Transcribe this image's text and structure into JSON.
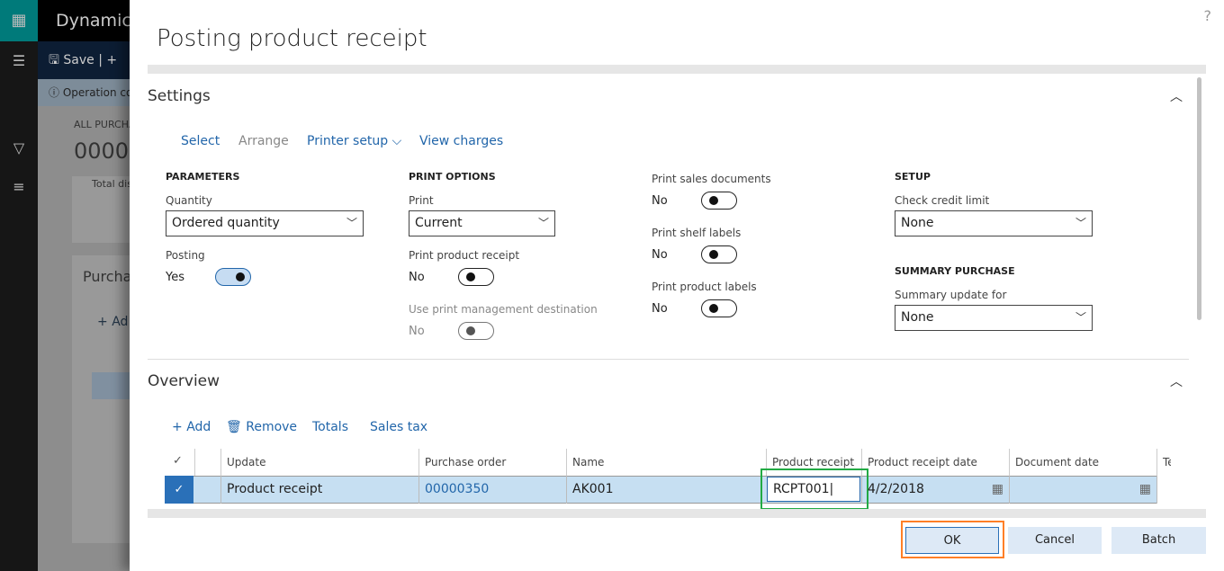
{
  "background": {
    "app_title": "Dynamics",
    "save_label": "Save",
    "info_text": "Operation co",
    "breadcrumb": "ALL PURCHA",
    "record_id": "0000",
    "total_label": "Total dis",
    "section_label": "Purcha",
    "add_label": "Ad"
  },
  "dialog": {
    "title": "Posting product receipt",
    "help_icon": "?",
    "settings": {
      "header": "Settings",
      "actions": [
        {
          "label": "Select",
          "enabled": true
        },
        {
          "label": "Arrange",
          "enabled": false
        },
        {
          "label": "Printer setup",
          "enabled": true
        },
        {
          "label": "View charges",
          "enabled": true
        }
      ],
      "parameters": {
        "heading": "PARAMETERS",
        "quantity_label": "Quantity",
        "quantity_value": "Ordered quantity",
        "posting_label": "Posting",
        "posting_value": "Yes"
      },
      "print_options": {
        "heading": "PRINT OPTIONS",
        "print_label": "Print",
        "print_value": "Current",
        "ppr_label": "Print product receipt",
        "ppr_value": "No",
        "upmd_label": "Use print management destination",
        "upmd_value": "No"
      },
      "print_docs": {
        "psd_label": "Print sales documents",
        "psd_value": "No",
        "psl_label": "Print shelf labels",
        "psl_value": "No",
        "ppl_label": "Print product labels",
        "ppl_value": "No"
      },
      "setup": {
        "heading": "SETUP",
        "ccl_label": "Check credit limit",
        "ccl_value": "None",
        "summary_heading": "SUMMARY PURCHASE",
        "suf_label": "Summary update for",
        "suf_value": "None"
      }
    },
    "overview": {
      "header": "Overview",
      "actions": {
        "add": "Add",
        "remove": "Remove",
        "totals": "Totals",
        "sales_tax": "Sales tax"
      },
      "columns": [
        "Update",
        "Purchase order",
        "Name",
        "Product receipt",
        "Product receipt date",
        "Document date",
        "Te"
      ],
      "rows": [
        {
          "update": "Product receipt",
          "purchase_order": "00000350",
          "name": "AK001",
          "product_receipt": "RCPT001",
          "product_receipt_date": "4/2/2018",
          "document_date": ""
        }
      ]
    },
    "buttons": {
      "ok": "OK",
      "cancel": "Cancel",
      "batch": "Batch"
    }
  },
  "colors": {
    "link": "#2266aa",
    "highlight_green": "#22aa44",
    "highlight_orange": "#ff7f27"
  }
}
